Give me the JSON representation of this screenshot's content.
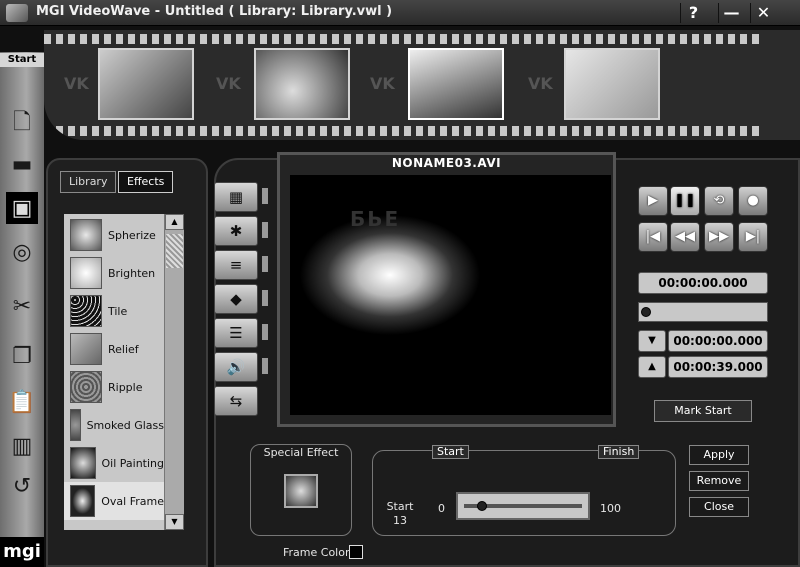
{
  "window": {
    "title": "MGI VideoWave - Untitled ( Library: Library.vwl )",
    "help_label": "?",
    "minimize_label": "—",
    "close_label": "✕"
  },
  "filmstrip": {
    "placeholder_mark": "VK"
  },
  "sidebar": {
    "start_label": "Start",
    "icons": [
      "document-icon",
      "folder-icon",
      "save-icon",
      "film-reel-icon",
      "scissors-icon",
      "copy-icon",
      "clipboard-icon",
      "camera-icon",
      "undo-icon"
    ],
    "logo": "mgi"
  },
  "library": {
    "tabs": [
      "Library",
      "Effects"
    ],
    "active_tab": "Effects",
    "effects": [
      "Spherize",
      "Brighten",
      "Tile",
      "Relief",
      "Ripple",
      "Smoked Glass",
      "Oil Painting",
      "Oval Frame"
    ],
    "selected_effect": "Oval Frame",
    "scroll_up": "▲",
    "scroll_down": "▼"
  },
  "tools": {
    "icons": [
      "film-icon",
      "transition-icon",
      "text-icon",
      "effects-icon",
      "video-text-icon",
      "audio-icon",
      "export-icon"
    ]
  },
  "preview": {
    "clip_name": "NONAME03.AVI",
    "video_text": "БЬЕ"
  },
  "playback": {
    "row1": [
      "▶",
      "❚❚",
      "⟲",
      "●"
    ],
    "row2": [
      "|◀",
      "◀◀",
      "▶▶",
      "▶|"
    ],
    "current_time": "00:00:00.000",
    "start_time": "00:00:00.000",
    "end_time": "00:00:39.000",
    "position": 0.0,
    "mark_start_label": "Mark Start",
    "in_marker": "▼",
    "out_marker": "▲"
  },
  "special_effect": {
    "label": "Special Effect",
    "frame_color_label": "Frame Color:"
  },
  "range": {
    "start_btn": "Start",
    "finish_btn": "Finish",
    "start_label": "Start",
    "start_value": "13",
    "min": "0",
    "max": "100",
    "value": 13
  },
  "actions": {
    "apply": "Apply",
    "remove": "Remove",
    "close": "Close"
  }
}
